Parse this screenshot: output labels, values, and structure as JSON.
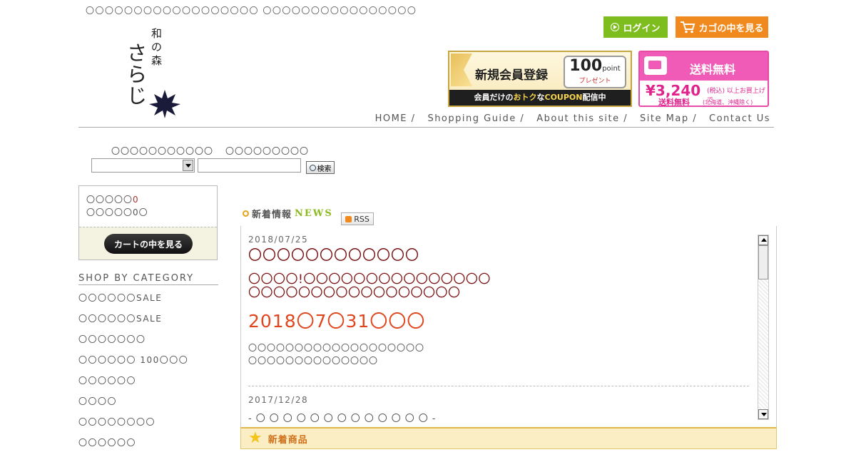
{
  "header": {
    "tagline": "〇〇〇〇〇〇〇〇〇〇〇〇〇〇〇〇〇〇 〇〇〇〇〇〇〇〇〇〇〇〇〇〇〇〇",
    "logo_top": "和の森",
    "logo_main": "さらじ",
    "login_label": "ログイン",
    "cart_label": "カゴの中を見る"
  },
  "banners": {
    "member_title": "新規会員登録",
    "member_points": "100",
    "member_points_unit": "point",
    "member_present": "プレゼント",
    "member_bar_pre": "会員だけの",
    "member_bar_hl1": "おトク",
    "member_bar_mid": "な",
    "member_bar_hl2": "COUPON",
    "member_bar_post": "配信中",
    "ship_title": "送料無料",
    "ship_price": "¥3,240",
    "ship_tax": "(税込) 以上お買上げで",
    "ship_free": "送料無料",
    "ship_note": "(北海道、沖縄除く)"
  },
  "nav": [
    {
      "label": "HOME"
    },
    {
      "label": "Shopping Guide"
    },
    {
      "label": "About this site"
    },
    {
      "label": "Site Map"
    },
    {
      "label": "Contact Us"
    }
  ],
  "search": {
    "category_label": "〇〇〇〇〇〇〇〇〇〇〇",
    "keyword_label": "〇〇〇〇〇〇〇〇〇",
    "button_label": "検索"
  },
  "cart": {
    "items_label": "〇〇〇〇〇",
    "items_value": "0",
    "total_label": "〇〇〇〇〇0〇",
    "view_cart_label": "カートの中を見る"
  },
  "category": {
    "title": "SHOP BY CATEGORY",
    "items": [
      {
        "label": "〇〇〇〇〇〇SALE"
      },
      {
        "label": "〇〇〇〇〇〇SALE"
      },
      {
        "label": "〇〇〇〇〇〇〇"
      },
      {
        "label": "〇〇〇〇〇〇 100〇〇〇"
      },
      {
        "label": "〇〇〇〇〇〇"
      },
      {
        "label": "〇〇〇〇"
      },
      {
        "label": "〇〇〇〇〇〇〇〇"
      },
      {
        "label": "〇〇〇〇〇〇"
      }
    ]
  },
  "news": {
    "heading_jp": "新着情報",
    "heading_en": "NEWS",
    "rss_label": "RSS",
    "entry1": {
      "date": "2018/07/25",
      "title": "〇〇〇〇〇〇〇〇〇〇〇〇",
      "body_line1": "〇〇〇〇!〇〇〇〇〇〇〇〇〇〇〇〇〇〇〇",
      "body_line2": "〇〇〇〇〇〇〇〇〇〇〇〇〇〇〇〇〇",
      "deadline": "2018〇7〇31〇〇〇",
      "text_line1": "〇〇〇〇〇〇〇〇〇〇〇〇〇〇〇〇〇〇〇",
      "text_line2": "〇〇〇〇〇〇〇〇〇〇〇〇〇〇"
    },
    "entry2": {
      "date": "2017/12/28",
      "title": "-〇〇〇〇〇〇〇〇〇〇〇〇〇-"
    }
  },
  "new_items": {
    "label": "新着商品"
  }
}
